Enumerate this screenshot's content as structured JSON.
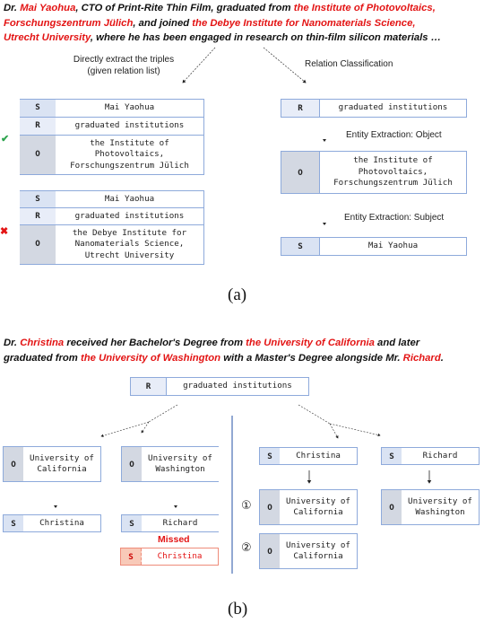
{
  "part_a": {
    "sentence": {
      "line1": [
        {
          "t": "Dr. ",
          "hl": false
        },
        {
          "t": "Mai Yaohua",
          "hl": true
        },
        {
          "t": ", CTO of Print-Rite Thin Film, graduated from ",
          "hl": false
        },
        {
          "t": "the Institute of Photovoltaics,",
          "hl": true
        }
      ],
      "line2": [
        {
          "t": "Forschungszentrum Jülich",
          "hl": true
        },
        {
          "t": ", and joined ",
          "hl": false
        },
        {
          "t": "the Debye Institute for Nanomaterials Science,",
          "hl": true
        }
      ],
      "line3": [
        {
          "t": "Utrecht University",
          "hl": true
        },
        {
          "t": ", where he has been engaged in research on thin-film silicon materials …",
          "hl": false
        }
      ]
    },
    "left_label_line1": "Directly extract the triples",
    "left_label_line2": "(given relation list)",
    "right_label": "Relation Classification",
    "entity_object_label": "Entity Extraction: Object",
    "entity_subject_label": "Entity Extraction: Subject",
    "triple1": {
      "mark": "✔",
      "mark_color": "#2ea44f",
      "s_key": "S",
      "s_val": "Mai Yaohua",
      "r_key": "R",
      "r_val": "graduated institutions",
      "o_key": "O",
      "o_val": "the Institute of\nPhotovoltaics,\nForschungszentrum Jülich"
    },
    "triple2": {
      "mark": "✖",
      "mark_color": "#e31414",
      "s_key": "S",
      "s_val": "Mai Yaohua",
      "r_key": "R",
      "r_val": "graduated institutions",
      "o_key": "O",
      "o_val": "the Debye Institute for\nNanomaterials Science,\nUtrecht University"
    },
    "right_r": {
      "key": "R",
      "val": "graduated institutions"
    },
    "right_o": {
      "key": "O",
      "val": "the Institute of\nPhotovoltaics,\nForschungszentrum Jülich"
    },
    "right_s": {
      "key": "S",
      "val": "Mai Yaohua"
    },
    "caption": "(a)"
  },
  "part_b": {
    "sentence": {
      "line1": [
        {
          "t": "Dr. ",
          "hl": false
        },
        {
          "t": "Christina",
          "hl": true
        },
        {
          "t": " received her Bachelor's Degree from ",
          "hl": false
        },
        {
          "t": "the University of California",
          "hl": true
        },
        {
          "t": " and later",
          "hl": false
        }
      ],
      "line2": [
        {
          "t": "graduated from ",
          "hl": false
        },
        {
          "t": "the University of Washington",
          "hl": true
        },
        {
          "t": " with a Master's Degree alongside Mr. ",
          "hl": false
        },
        {
          "t": "Richard",
          "hl": true
        },
        {
          "t": ".",
          "hl": false
        }
      ]
    },
    "top_r": {
      "key": "R",
      "val": "graduated institutions"
    },
    "left": {
      "o1": {
        "key": "O",
        "val": "University of\nCalifornia"
      },
      "o2": {
        "key": "O",
        "val": "University of\nWashington"
      },
      "s1": {
        "key": "S",
        "val": "Christina"
      },
      "s2": {
        "key": "S",
        "val": "Richard"
      },
      "missed_label": "Missed",
      "missed": {
        "key": "S",
        "val": "Christina"
      }
    },
    "right": {
      "s1": {
        "key": "S",
        "val": "Christina"
      },
      "s2": {
        "key": "S",
        "val": "Richard"
      },
      "o1": {
        "key": "O",
        "val": "University of\nCalifornia",
        "marker": "①"
      },
      "o2": {
        "key": "O",
        "val": "University of\nCalifornia",
        "marker": "②"
      },
      "o3": {
        "key": "O",
        "val": "University of\nWashington"
      }
    },
    "caption": "(b)"
  },
  "colors": {
    "highlight": "#e31414",
    "border": "#8eaadb",
    "divider": "#4a6fb5"
  }
}
